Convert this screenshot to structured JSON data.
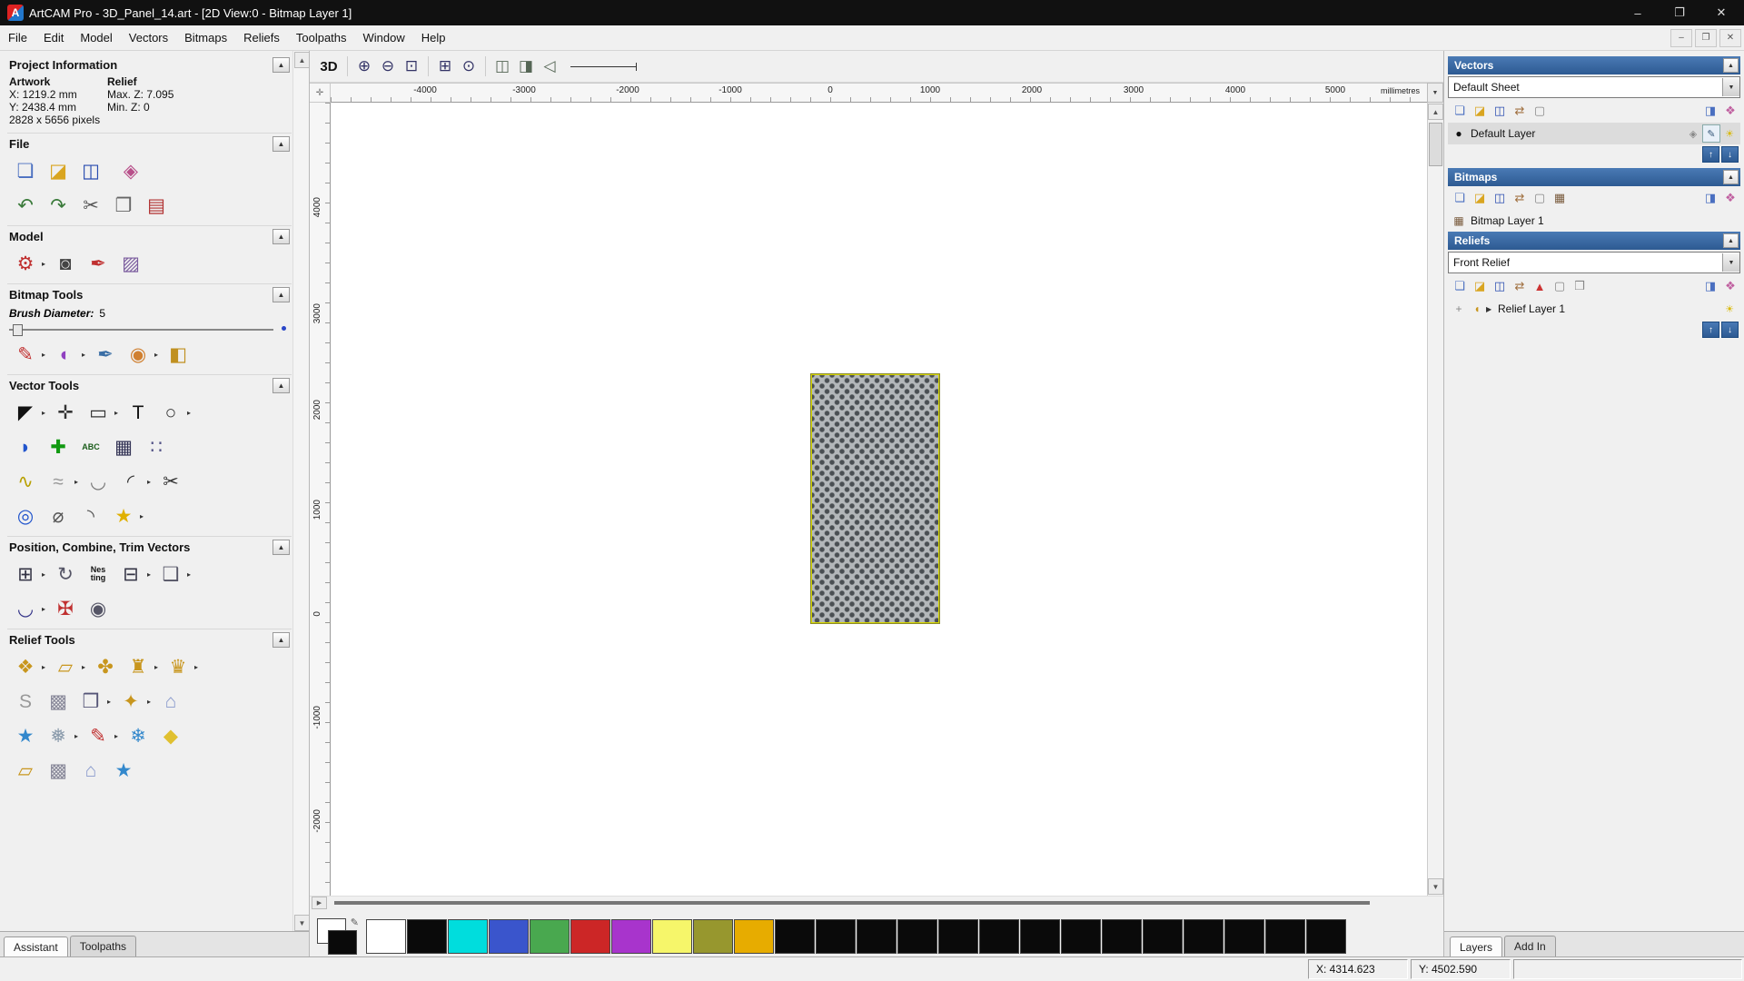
{
  "titlebar": {
    "app_initial": "A",
    "title": "ArtCAM Pro - 3D_Panel_14.art - [2D View:0 - Bitmap Layer 1]",
    "minimize": "–",
    "maximize": "❐",
    "close": "✕"
  },
  "menubar": {
    "items": [
      "File",
      "Edit",
      "Model",
      "Vectors",
      "Bitmaps",
      "Reliefs",
      "Toolpaths",
      "Window",
      "Help"
    ],
    "mdi_minimize": "–",
    "mdi_restore": "❐",
    "mdi_close": "✕"
  },
  "assistant": {
    "project_information": {
      "title": "Project Information",
      "artwork_header": "Artwork",
      "relief_header": "Relief",
      "x": "X: 1219.2 mm",
      "max_z": "Max. Z: 7.095",
      "y": "Y: 2438.4 mm",
      "min_z": "Min. Z: 0",
      "pixels": "2828 x 5656 pixels"
    },
    "sections": {
      "file": "File",
      "model": "Model",
      "bitmap_tools": "Bitmap Tools",
      "vector_tools": "Vector Tools",
      "position": "Position, Combine, Trim Vectors",
      "relief_tools": "Relief Tools"
    },
    "brush_label": "Brush Diameter:",
    "brush_value": "5",
    "tabs": {
      "assistant": "Assistant",
      "toolpaths": "Toolpaths"
    }
  },
  "canvas": {
    "view3d": "3D",
    "units": "millimetres",
    "h_ticks": [
      "-4000",
      "-3000",
      "-2000",
      "-1000",
      "0",
      "1000",
      "2000",
      "3000",
      "4000",
      "5000"
    ],
    "v_ticks": [
      "4000",
      "3000",
      "2000",
      "1000",
      "0",
      "-1000",
      "-2000"
    ]
  },
  "panels": {
    "vectors": {
      "title": "Vectors",
      "sheet": "Default Sheet",
      "layer": "Default Layer"
    },
    "bitmaps": {
      "title": "Bitmaps",
      "layer": "Bitmap Layer 1"
    },
    "reliefs": {
      "title": "Reliefs",
      "selected": "Front Relief",
      "layer": "Relief Layer 1"
    },
    "tabs": {
      "layers": "Layers",
      "addin": "Add In"
    }
  },
  "statusbar": {
    "x_value": "X: 4314.623",
    "y_value": "Y: 4502.590"
  },
  "palette": [
    "#ffffff",
    "#0a0a0a",
    "#00dddd",
    "#3a55cc",
    "#49a84f",
    "#cc2626",
    "#a834cc",
    "#f6f66a",
    "#97972e",
    "#e7ac00",
    "#0a0a0a",
    "#0a0a0a",
    "#0a0a0a",
    "#0a0a0a",
    "#0a0a0a",
    "#0a0a0a",
    "#0a0a0a",
    "#0a0a0a",
    "#0a0a0a",
    "#0a0a0a",
    "#0a0a0a",
    "#0a0a0a",
    "#0a0a0a",
    "#0a0a0a"
  ],
  "icons": {
    "collapse": {
      "g": "▲",
      "c": "#333333"
    },
    "dropdown": {
      "g": "▼",
      "c": "#333333"
    },
    "flyout": {
      "g": "▸",
      "c": "#333333"
    },
    "expander": {
      "g": "▶",
      "c": "#333333"
    },
    "scroll_up": {
      "g": "▲",
      "c": "#555555"
    },
    "scroll_down": {
      "g": "▼",
      "c": "#555555"
    },
    "scroll_right": {
      "g": "▶",
      "c": "#555555"
    },
    "origin": {
      "g": "✛",
      "c": "#888888"
    },
    "new": {
      "g": "❏",
      "c": "#4a6fc0"
    },
    "open": {
      "g": "◪",
      "c": "#d9a520"
    },
    "save": {
      "g": "◫",
      "c": "#2a4db0"
    },
    "import": {
      "g": "◈",
      "c": "#b8508a"
    },
    "undo": {
      "g": "↶",
      "c": "#3a7a3a"
    },
    "redo": {
      "g": "↷",
      "c": "#3a7a3a"
    },
    "cut": {
      "g": "✂",
      "c": "#555555"
    },
    "copy": {
      "g": "❐",
      "c": "#666666"
    },
    "paste": {
      "g": "▤",
      "c": "#b03030"
    },
    "model_size": {
      "g": "⚙",
      "c": "#c03030"
    },
    "model_grey": {
      "g": "◙",
      "c": "#444444"
    },
    "model_sculpt": {
      "g": "✒",
      "c": "#c03030"
    },
    "model_image": {
      "g": "▨",
      "c": "#7a5c9e"
    },
    "paint": {
      "g": "✎",
      "c": "#c03030"
    },
    "blend": {
      "g": "◐",
      "c": "#9040c0"
    },
    "pick": {
      "g": "✒",
      "c": "#3a6ea5"
    },
    "palette_tool": {
      "g": "◉",
      "c": "#d08030"
    },
    "fill": {
      "g": "◧",
      "c": "#c09020"
    },
    "select": {
      "g": "◤",
      "c": "#111111"
    },
    "transform": {
      "g": "✛",
      "c": "#333333"
    },
    "rect_tool": {
      "g": "▭",
      "c": "#333333"
    },
    "text_tool": {
      "g": "T",
      "c": "#111111"
    },
    "ellipse_tool": {
      "g": "○",
      "c": "#333333"
    },
    "airbrush": {
      "g": "◗",
      "c": "#2255cc"
    },
    "green_cross": {
      "g": "✚",
      "c": "#119911"
    },
    "abc": {
      "g": "ABC",
      "c": "#1a5c1a"
    },
    "grid_tool": {
      "g": "▦",
      "c": "#333355"
    },
    "points_tool": {
      "g": "∷",
      "c": "#555588"
    },
    "polyline": {
      "g": "∿",
      "c": "#b8a000"
    },
    "freehand": {
      "g": "≈",
      "c": "#999999"
    },
    "bezier": {
      "g": "◡",
      "c": "#777777"
    },
    "arc_tool": {
      "g": "◜",
      "c": "#333333"
    },
    "node_cut": {
      "g": "✂",
      "c": "#333333"
    },
    "revolve": {
      "g": "◎",
      "c": "#2255cc"
    },
    "measure": {
      "g": "⌀",
      "c": "#555555"
    },
    "fillet": {
      "g": "◝",
      "c": "#555555"
    },
    "star_tool": {
      "g": "★",
      "c": "#e0b000"
    },
    "align": {
      "g": "⊞",
      "c": "#333344"
    },
    "circ_copy": {
      "g": "↻",
      "c": "#555566"
    },
    "nesting": {
      "g": "Nes\nting",
      "c": "#111111"
    },
    "block_copy": {
      "g": "⊟",
      "c": "#333344"
    },
    "paste_along": {
      "g": "❑",
      "c": "#555566"
    },
    "join_vectors": {
      "g": "◡",
      "c": "#333388"
    },
    "weld": {
      "g": "✠",
      "c": "#c03030"
    },
    "spiral": {
      "g": "◉",
      "c": "#555566"
    },
    "relief_sculpt": {
      "g": "❖",
      "c": "#c8961e"
    },
    "relief_plane": {
      "g": "▱",
      "c": "#c8961e"
    },
    "relief_add": {
      "g": "✤",
      "c": "#c8961e"
    },
    "relief_turn": {
      "g": "♜",
      "c": "#c8961e"
    },
    "relief_crown": {
      "g": "♛",
      "c": "#c8961e"
    },
    "relief_smooth": {
      "g": "S",
      "c": "#999999"
    },
    "relief_weave": {
      "g": "▩",
      "c": "#888899"
    },
    "relief_copy": {
      "g": "❒",
      "c": "#555577"
    },
    "relief_gold": {
      "g": "✦",
      "c": "#c8961e"
    },
    "relief_lamp": {
      "g": "⌂",
      "c": "#8899cc"
    },
    "relief_star": {
      "g": "★",
      "c": "#3388cc"
    },
    "relief_face": {
      "g": "❅",
      "c": "#8899aa"
    },
    "relief_paint": {
      "g": "✎",
      "c": "#c03030"
    },
    "relief_texture": {
      "g": "❄",
      "c": "#3388cc"
    },
    "relief_wedge": {
      "g": "◆",
      "c": "#e0c030"
    },
    "zoom_in": {
      "g": "⊕",
      "c": "#333366"
    },
    "zoom_out": {
      "g": "⊖",
      "c": "#333366"
    },
    "zoom_window": {
      "g": "⊡",
      "c": "#333366"
    },
    "zoom_fit": {
      "g": "⊞",
      "c": "#333366"
    },
    "zoom_obj": {
      "g": "⊙",
      "c": "#333366"
    },
    "view_prev": {
      "g": "◫",
      "c": "#556655"
    },
    "view_pan": {
      "g": "◨",
      "c": "#556655"
    },
    "view_back": {
      "g": "◁",
      "c": "#556655"
    },
    "layer_new": {
      "g": "❏",
      "c": "#4a6fc0"
    },
    "layer_open": {
      "g": "◪",
      "c": "#d9a520"
    },
    "layer_save": {
      "g": "◫",
      "c": "#2a4db0"
    },
    "layer_transfer": {
      "g": "⇄",
      "c": "#a07040"
    },
    "layer_page": {
      "g": "▢",
      "c": "#888888"
    },
    "layer_toggle": {
      "g": "◨",
      "c": "#4a6fc0"
    },
    "layer_merge": {
      "g": "❒",
      "c": "#888888"
    },
    "layer_colour": {
      "g": "❖",
      "c": "#c060a0"
    },
    "relief_red": {
      "g": "▲",
      "c": "#cc3333"
    },
    "black_dot": {
      "g": "●",
      "c": "#111111"
    },
    "lock": {
      "g": "◈",
      "c": "#888888"
    },
    "edit_pen": {
      "g": "✎",
      "c": "#335577"
    },
    "lamp": {
      "g": "☀",
      "c": "#d8b800"
    },
    "plus": {
      "g": "+",
      "c": "#888888"
    },
    "bitmap_thumb": {
      "g": "▦",
      "c": "#7a5c3e"
    },
    "relief_thumb": {
      "g": "◖",
      "c": "#c8961e"
    },
    "up": {
      "g": "↑",
      "c": "#ffffff"
    },
    "down": {
      "g": "↓",
      "c": "#ffffff"
    },
    "pen_small": {
      "g": "✎",
      "c": "#555555"
    }
  }
}
